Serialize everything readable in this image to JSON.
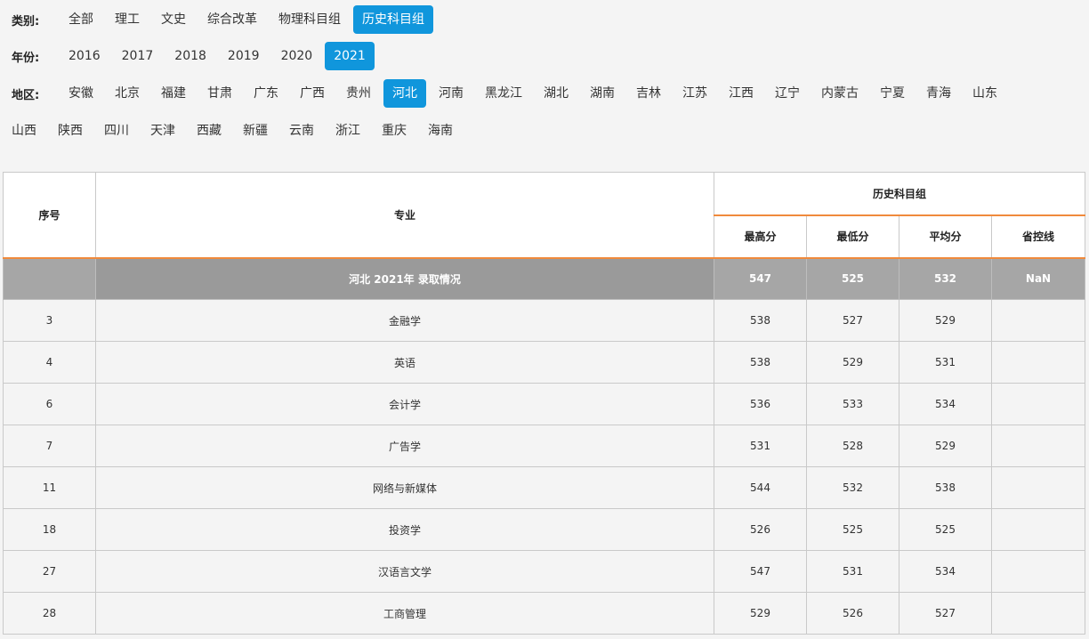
{
  "filters": {
    "category": {
      "label": "类别:",
      "options": [
        "全部",
        "理工",
        "文史",
        "综合改革",
        "物理科目组",
        "历史科目组"
      ],
      "selected": "历史科目组"
    },
    "year": {
      "label": "年份:",
      "options": [
        "2016",
        "2017",
        "2018",
        "2019",
        "2020",
        "2021"
      ],
      "selected": "2021"
    },
    "region": {
      "label": "地区:",
      "options_row1": [
        "安徽",
        "北京",
        "福建",
        "甘肃",
        "广东",
        "广西",
        "贵州",
        "河北",
        "河南",
        "黑龙江",
        "湖北",
        "湖南",
        "吉林",
        "江苏",
        "江西",
        "辽宁",
        "内蒙古",
        "宁夏",
        "青海",
        "山东"
      ],
      "options_row2": [
        "山西",
        "陕西",
        "四川",
        "天津",
        "西藏",
        "新疆",
        "云南",
        "浙江",
        "重庆",
        "海南"
      ],
      "selected": "河北"
    }
  },
  "table": {
    "headers": {
      "index": "序号",
      "major": "专业",
      "group": "历史科目组",
      "max": "最高分",
      "min": "最低分",
      "avg": "平均分",
      "control": "省控线"
    },
    "summary": {
      "index": "",
      "major": "河北 2021年 录取情况",
      "max": "547",
      "min": "525",
      "avg": "532",
      "control": "NaN"
    },
    "rows": [
      {
        "index": "3",
        "major": "金融学",
        "max": "538",
        "min": "527",
        "avg": "529",
        "control": ""
      },
      {
        "index": "4",
        "major": "英语",
        "max": "538",
        "min": "529",
        "avg": "531",
        "control": ""
      },
      {
        "index": "6",
        "major": "会计学",
        "max": "536",
        "min": "533",
        "avg": "534",
        "control": ""
      },
      {
        "index": "7",
        "major": "广告学",
        "max": "531",
        "min": "528",
        "avg": "529",
        "control": ""
      },
      {
        "index": "11",
        "major": "网络与新媒体",
        "max": "544",
        "min": "532",
        "avg": "538",
        "control": ""
      },
      {
        "index": "18",
        "major": "投资学",
        "max": "526",
        "min": "525",
        "avg": "525",
        "control": ""
      },
      {
        "index": "27",
        "major": "汉语言文学",
        "max": "547",
        "min": "531",
        "avg": "534",
        "control": ""
      },
      {
        "index": "28",
        "major": "工商管理",
        "max": "529",
        "min": "526",
        "avg": "527",
        "control": ""
      }
    ]
  }
}
